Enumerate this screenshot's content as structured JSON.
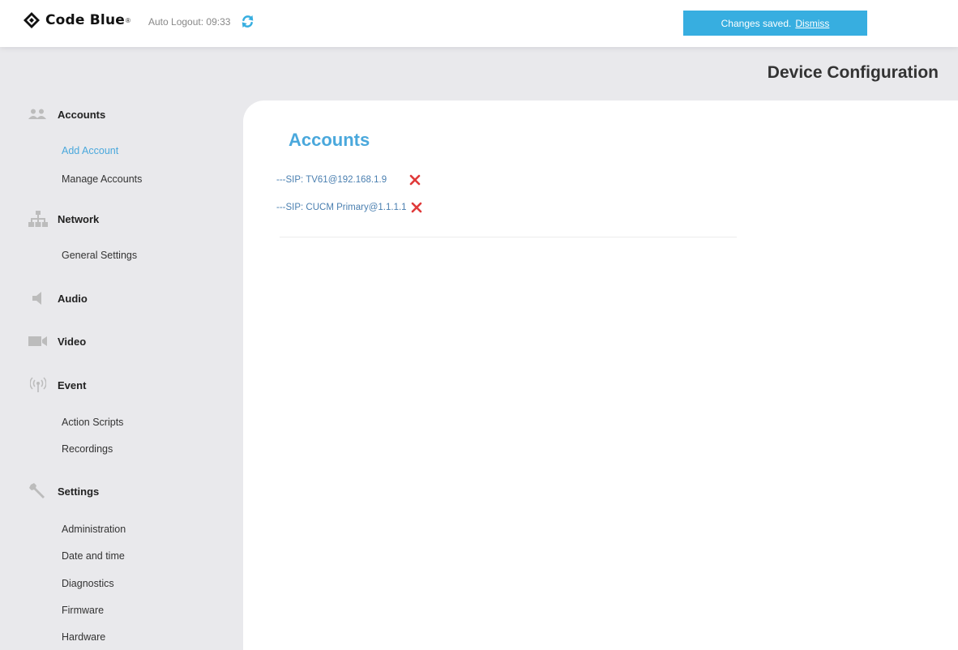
{
  "header": {
    "brand": "Code Blue",
    "trademark": "®",
    "auto_logout": "Auto Logout: 09:33",
    "toast_message": "Changes saved.",
    "toast_dismiss": "Dismiss",
    "accent_color": "#37aee0"
  },
  "page_title": "Device Configuration",
  "sidebar": {
    "sections": [
      {
        "label": "Accounts",
        "icon": "users-icon",
        "items": [
          "Add Account",
          "Manage Accounts"
        ],
        "active_item": "Add Account"
      },
      {
        "label": "Network",
        "icon": "network-icon",
        "items": [
          "General Settings"
        ]
      },
      {
        "label": "Audio",
        "icon": "speaker-icon",
        "items": []
      },
      {
        "label": "Video",
        "icon": "video-camera-icon",
        "items": []
      },
      {
        "label": "Event",
        "icon": "broadcast-icon",
        "items": [
          "Action Scripts",
          "Recordings"
        ]
      },
      {
        "label": "Settings",
        "icon": "wrench-icon",
        "items": [
          "Administration",
          "Date and time",
          "Diagnostics",
          "Firmware",
          "Hardware"
        ]
      }
    ]
  },
  "main": {
    "title": "Accounts",
    "accounts": [
      {
        "label": "---SIP: TV61@192.168.1.9",
        "delete_icon": "delete-x-icon"
      },
      {
        "label": "---SIP: CUCM Primary@1.1.1.1",
        "delete_icon": "delete-x-icon"
      }
    ],
    "delete_color": "#e03a3a"
  }
}
